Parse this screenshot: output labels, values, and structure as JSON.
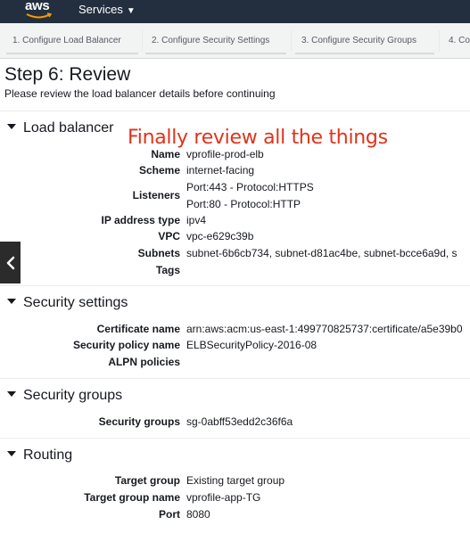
{
  "topbar": {
    "logo_text": "aws",
    "services_label": "Services",
    "services_caret": "▼"
  },
  "wizard": {
    "steps": [
      "1. Configure Load Balancer",
      "2. Configure Security Settings",
      "3. Configure Security Groups",
      "4. Co"
    ]
  },
  "page": {
    "title": "Step 6: Review",
    "subtitle": "Please review the load balancer details before continuing"
  },
  "annotation": "Finally review all the things",
  "sections": {
    "load_balancer": {
      "heading": "Load balancer",
      "name_label": "Name",
      "name_value": "vprofile-prod-elb",
      "scheme_label": "Scheme",
      "scheme_value": "internet-facing",
      "listeners_label": "Listeners",
      "listener_1": "Port:443 - Protocol:HTTPS",
      "listener_2": "Port:80 - Protocol:HTTP",
      "ip_label": "IP address type",
      "ip_value": "ipv4",
      "vpc_label": "VPC",
      "vpc_value": "vpc-e629c39b",
      "subnets_label": "Subnets",
      "subnets_value": "subnet-6b6cb734, subnet-d81ac4be, subnet-bcce6a9d, s",
      "tags_label": "Tags"
    },
    "security_settings": {
      "heading": "Security settings",
      "cert_label": "Certificate name",
      "cert_value": "arn:aws:acm:us-east-1:499770825737:certificate/a5e39b0",
      "policy_label": "Security policy name",
      "policy_value": "ELBSecurityPolicy-2016-08",
      "alpn_label": "ALPN policies"
    },
    "security_groups": {
      "heading": "Security groups",
      "sg_label": "Security groups",
      "sg_value": "sg-0abff53edd2c36f6a"
    },
    "routing": {
      "heading": "Routing",
      "tg_label": "Target group",
      "tg_value": "Existing target group",
      "tgname_label": "Target group name",
      "tgname_value": "vprofile-app-TG",
      "port_label": "Port",
      "port_value": "8080"
    }
  },
  "nav": {
    "prev_glyph": "‹"
  },
  "colors": {
    "topbar": "#232f3e",
    "annotation": "#e0331b",
    "wizard_bg": "#f2f3f3"
  }
}
